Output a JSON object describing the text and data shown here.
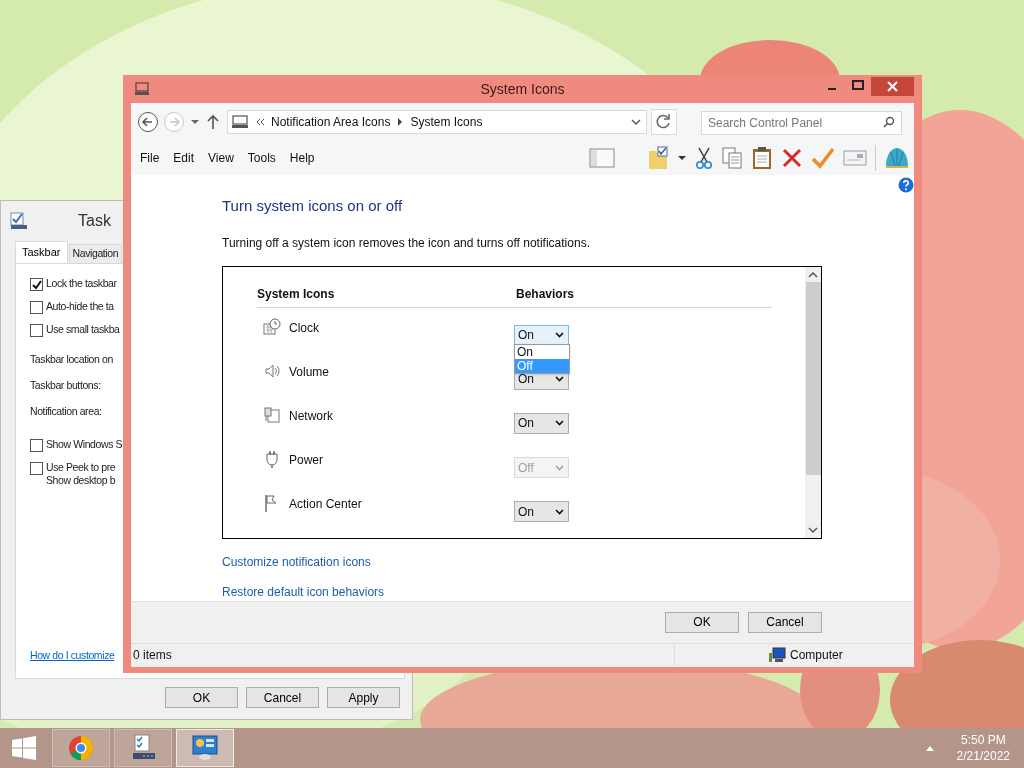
{
  "taskbar_properties": {
    "title": "Task",
    "tabs": [
      {
        "label": "Taskbar",
        "selected": true
      },
      {
        "label": "Navigation",
        "selected": false
      }
    ],
    "options": [
      {
        "kind": "checkbox",
        "label": "Lock the taskbar",
        "checked": true
      },
      {
        "kind": "checkbox",
        "label": "Auto-hide the ta",
        "checked": false
      },
      {
        "kind": "checkbox",
        "label": "Use small taskba",
        "checked": false
      },
      {
        "kind": "label",
        "label": "Taskbar location on"
      },
      {
        "kind": "label",
        "label": "Taskbar buttons:"
      },
      {
        "kind": "label",
        "label": "Notification area:"
      },
      {
        "kind": "checkbox",
        "label": "Show Windows S",
        "checked": false
      },
      {
        "kind": "checkbox",
        "label": "Use Peek to pre\nShow desktop b",
        "checked": false
      }
    ],
    "link": "How do I customize",
    "buttons": [
      "OK",
      "Cancel",
      "Apply"
    ]
  },
  "window": {
    "title": "System Icons",
    "address": [
      "Notification Area Icons",
      "System Icons"
    ],
    "search": {
      "placeholder": "Search Control Panel"
    },
    "menu": [
      "File",
      "Edit",
      "View",
      "Tools",
      "Help"
    ],
    "heading": "Turn system icons on or off",
    "description": "Turning off a system icon removes the icon and turns off notifications.",
    "columns": [
      "System Icons",
      "Behaviors"
    ],
    "rows": [
      {
        "kind": "clock",
        "name": "Clock",
        "behavior": "On",
        "disabled": false,
        "focused": true
      },
      {
        "kind": "volume",
        "name": "Volume",
        "behavior": "On",
        "disabled": false,
        "focused": false
      },
      {
        "kind": "network",
        "name": "Network",
        "behavior": "On",
        "disabled": false,
        "focused": false
      },
      {
        "kind": "power",
        "name": "Power",
        "behavior": "Off",
        "disabled": true,
        "focused": false
      },
      {
        "kind": "flag",
        "name": "Action Center",
        "behavior": "On",
        "disabled": false,
        "focused": false
      }
    ],
    "dropdown": [
      {
        "label": "On",
        "selected": false
      },
      {
        "label": "Off",
        "selected": true
      }
    ],
    "links": [
      "Customize notification icons",
      "Restore default icon behaviors"
    ],
    "buttons": [
      "OK",
      "Cancel"
    ],
    "status_bar": {
      "items": "0 items",
      "location": "Computer"
    }
  },
  "taskbar": {
    "apps": [
      {
        "kind": "browser",
        "selected": false
      },
      {
        "kind": "checklist",
        "selected": false
      },
      {
        "kind": "control-panel",
        "selected": true
      }
    ],
    "time": "5:50 PM",
    "date": "2/21/2022"
  }
}
